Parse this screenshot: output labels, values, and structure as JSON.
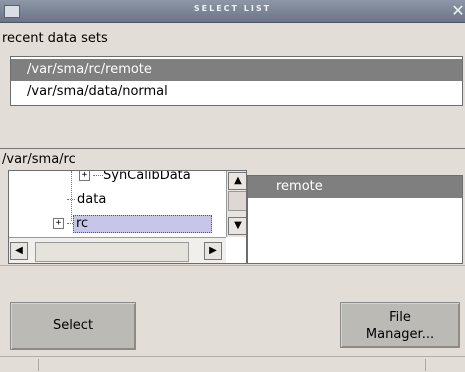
{
  "window": {
    "title": "SELECT LIST"
  },
  "recent": {
    "label": "recent data sets",
    "items": [
      "/var/sma/rc/remote",
      "/var/sma/data/normal"
    ],
    "selected_index": 0
  },
  "browser": {
    "current_path": "/var/sma/rc",
    "tree": {
      "items": [
        {
          "label": "SynCalibData",
          "expander": "+"
        },
        {
          "label": "data",
          "expander": ""
        },
        {
          "label": "rc",
          "expander": "+"
        }
      ],
      "selected_index": 2
    },
    "files": {
      "items": [
        "remote"
      ],
      "selected_index": 0
    }
  },
  "buttons": {
    "select": "Select",
    "file_manager_line1": "File",
    "file_manager_line2": "Manager..."
  },
  "colors": {
    "background": "#e2ddd6",
    "selection": "#7f7f7f",
    "tree_selection": "#c7c6e8"
  }
}
